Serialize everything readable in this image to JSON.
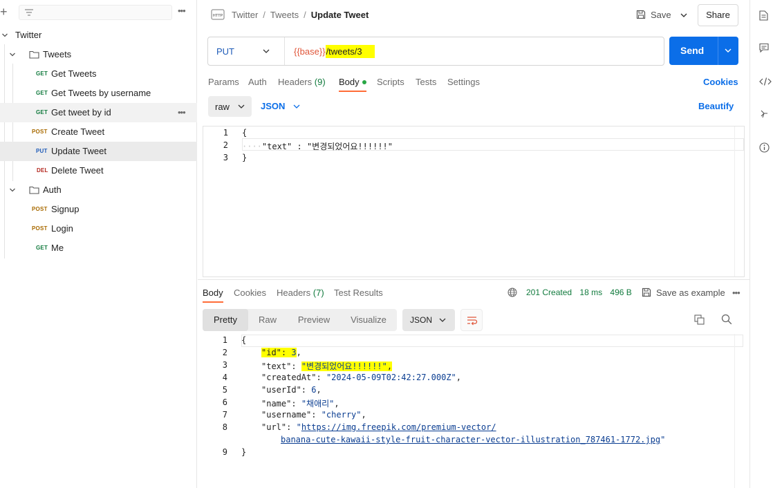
{
  "sidebar": {
    "collection": "Twitter",
    "folders": [
      {
        "name": "Tweets",
        "items": [
          {
            "method": "GET",
            "label": "Get Tweets"
          },
          {
            "method": "GET",
            "label": "Get Tweets by username"
          },
          {
            "method": "GET",
            "label": "Get tweet by id"
          },
          {
            "method": "POST",
            "label": "Create Tweet"
          },
          {
            "method": "PUT",
            "label": "Update Tweet"
          },
          {
            "method": "DEL",
            "label": "Delete Tweet"
          }
        ]
      },
      {
        "name": "Auth",
        "items": [
          {
            "method": "POST",
            "label": "Signup"
          },
          {
            "method": "POST",
            "label": "Login"
          },
          {
            "method": "GET",
            "label": "Me"
          }
        ]
      }
    ]
  },
  "header": {
    "icon_text": "HTTP",
    "breadcrumb": [
      "Twitter",
      "Tweets",
      "Update Tweet"
    ],
    "save_label": "Save",
    "share_label": "Share"
  },
  "request": {
    "method": "PUT",
    "url_variable": "{{base}}",
    "url_path": "/tweets/3",
    "send_label": "Send",
    "tabs": {
      "params": "Params",
      "auth": "Auth",
      "headers": "Headers",
      "headers_count": "(9)",
      "body": "Body",
      "scripts": "Scripts",
      "tests": "Tests",
      "settings": "Settings"
    },
    "cookies_label": "Cookies",
    "body_mode": "raw",
    "body_format": "JSON",
    "beautify_label": "Beautify",
    "body_lines": [
      {
        "n": "1",
        "text": "{"
      },
      {
        "n": "2",
        "ws": "····",
        "key": "\"text\"",
        "sep": " : ",
        "value": "\"변경되었어요!!!!!!\""
      },
      {
        "n": "3",
        "text": "}"
      }
    ]
  },
  "response": {
    "tabs": {
      "body": "Body",
      "cookies": "Cookies",
      "headers": "Headers",
      "headers_count": "(7)",
      "test_results": "Test Results"
    },
    "status": "201 Created",
    "time": "18 ms",
    "size": "496 B",
    "save_example_label": "Save as example",
    "view_tabs": [
      "Pretty",
      "Raw",
      "Preview",
      "Visualize"
    ],
    "format": "JSON",
    "lines": [
      {
        "n": "1",
        "text": "{"
      },
      {
        "n": "2",
        "key": "\"id\"",
        "value": "3",
        "trail": ","
      },
      {
        "n": "3",
        "key": "\"text\"",
        "value": "\"변경되었어요!!!!!!\"",
        "trail": ","
      },
      {
        "n": "4",
        "key": "\"createdAt\"",
        "value": "\"2024-05-09T02:42:27.000Z\"",
        "trail": ","
      },
      {
        "n": "5",
        "key": "\"userId\"",
        "value": "6",
        "trail": ","
      },
      {
        "n": "6",
        "key": "\"name\"",
        "value": "\"채애리\"",
        "trail": ","
      },
      {
        "n": "7",
        "key": "\"username\"",
        "value": "\"cherry\"",
        "trail": ","
      },
      {
        "n": "8",
        "key": "\"url\"",
        "value_prefix": "\"",
        "url_part1": "https://img.freepik.com/premium-vector/",
        "url_part2": "banana-cute-kawaii-style-fruit-character-vector-illustration_787461-1772.jpg",
        "value_suffix": "\""
      },
      {
        "n": "9",
        "text": "}"
      }
    ]
  },
  "colors": {
    "accent": "#0b6ee8",
    "tab_indicator": "#ff6c37",
    "highlight": "#ffff00",
    "get": "#117a3d",
    "post": "#a86a00",
    "put": "#1e5bb8",
    "delete": "#b3261e"
  }
}
